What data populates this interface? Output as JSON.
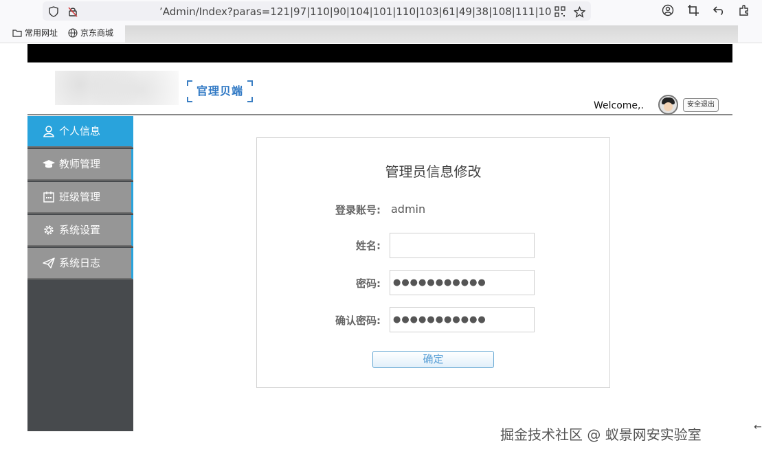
{
  "browser": {
    "url_suffix": "’Admin/Index?paras=121|97|110|90|104|101|110|103|61|49|38|108|111|103|105|110",
    "icons": [
      "shield-icon",
      "lock-slash-icon",
      "qr-code-icon",
      "star-icon",
      "account-icon",
      "crop-icon",
      "undo-icon",
      "extensions-icon"
    ],
    "bookmarks": [
      {
        "label": "常用网址",
        "icon": "folder-icon"
      },
      {
        "label": "京东商城",
        "icon": "globe-icon"
      }
    ]
  },
  "header": {
    "logo_text": "官理贝端",
    "welcome": "Welcome,.",
    "logout_label": "安全退出"
  },
  "sidebar": {
    "items": [
      {
        "label": "个人信息",
        "icon": "user-icon",
        "active": true
      },
      {
        "label": "教师管理",
        "icon": "graduation-cap-icon",
        "active": false
      },
      {
        "label": "班级管理",
        "icon": "calendar-icon",
        "active": false
      },
      {
        "label": "系统设置",
        "icon": "gear-icon",
        "active": false
      },
      {
        "label": "系统日志",
        "icon": "paper-plane-icon",
        "active": false
      }
    ]
  },
  "form": {
    "title": "管理员信息修改",
    "account_label": "登录账号:",
    "account_value": "admin",
    "name_label": "姓名:",
    "name_value": "",
    "password_label": "密码:",
    "password_value": "●●●●●●●●●●●",
    "confirm_label": "确认密码:",
    "confirm_value": "●●●●●●●●●●●",
    "submit_label": "确定"
  },
  "watermark": "掘金技术社区 @ 蚁景网安实验室",
  "colors": {
    "accent": "#29a3dc",
    "sidebar_item": "#969696",
    "sidebar_bg": "#474a4d",
    "top_band": "#000000"
  }
}
